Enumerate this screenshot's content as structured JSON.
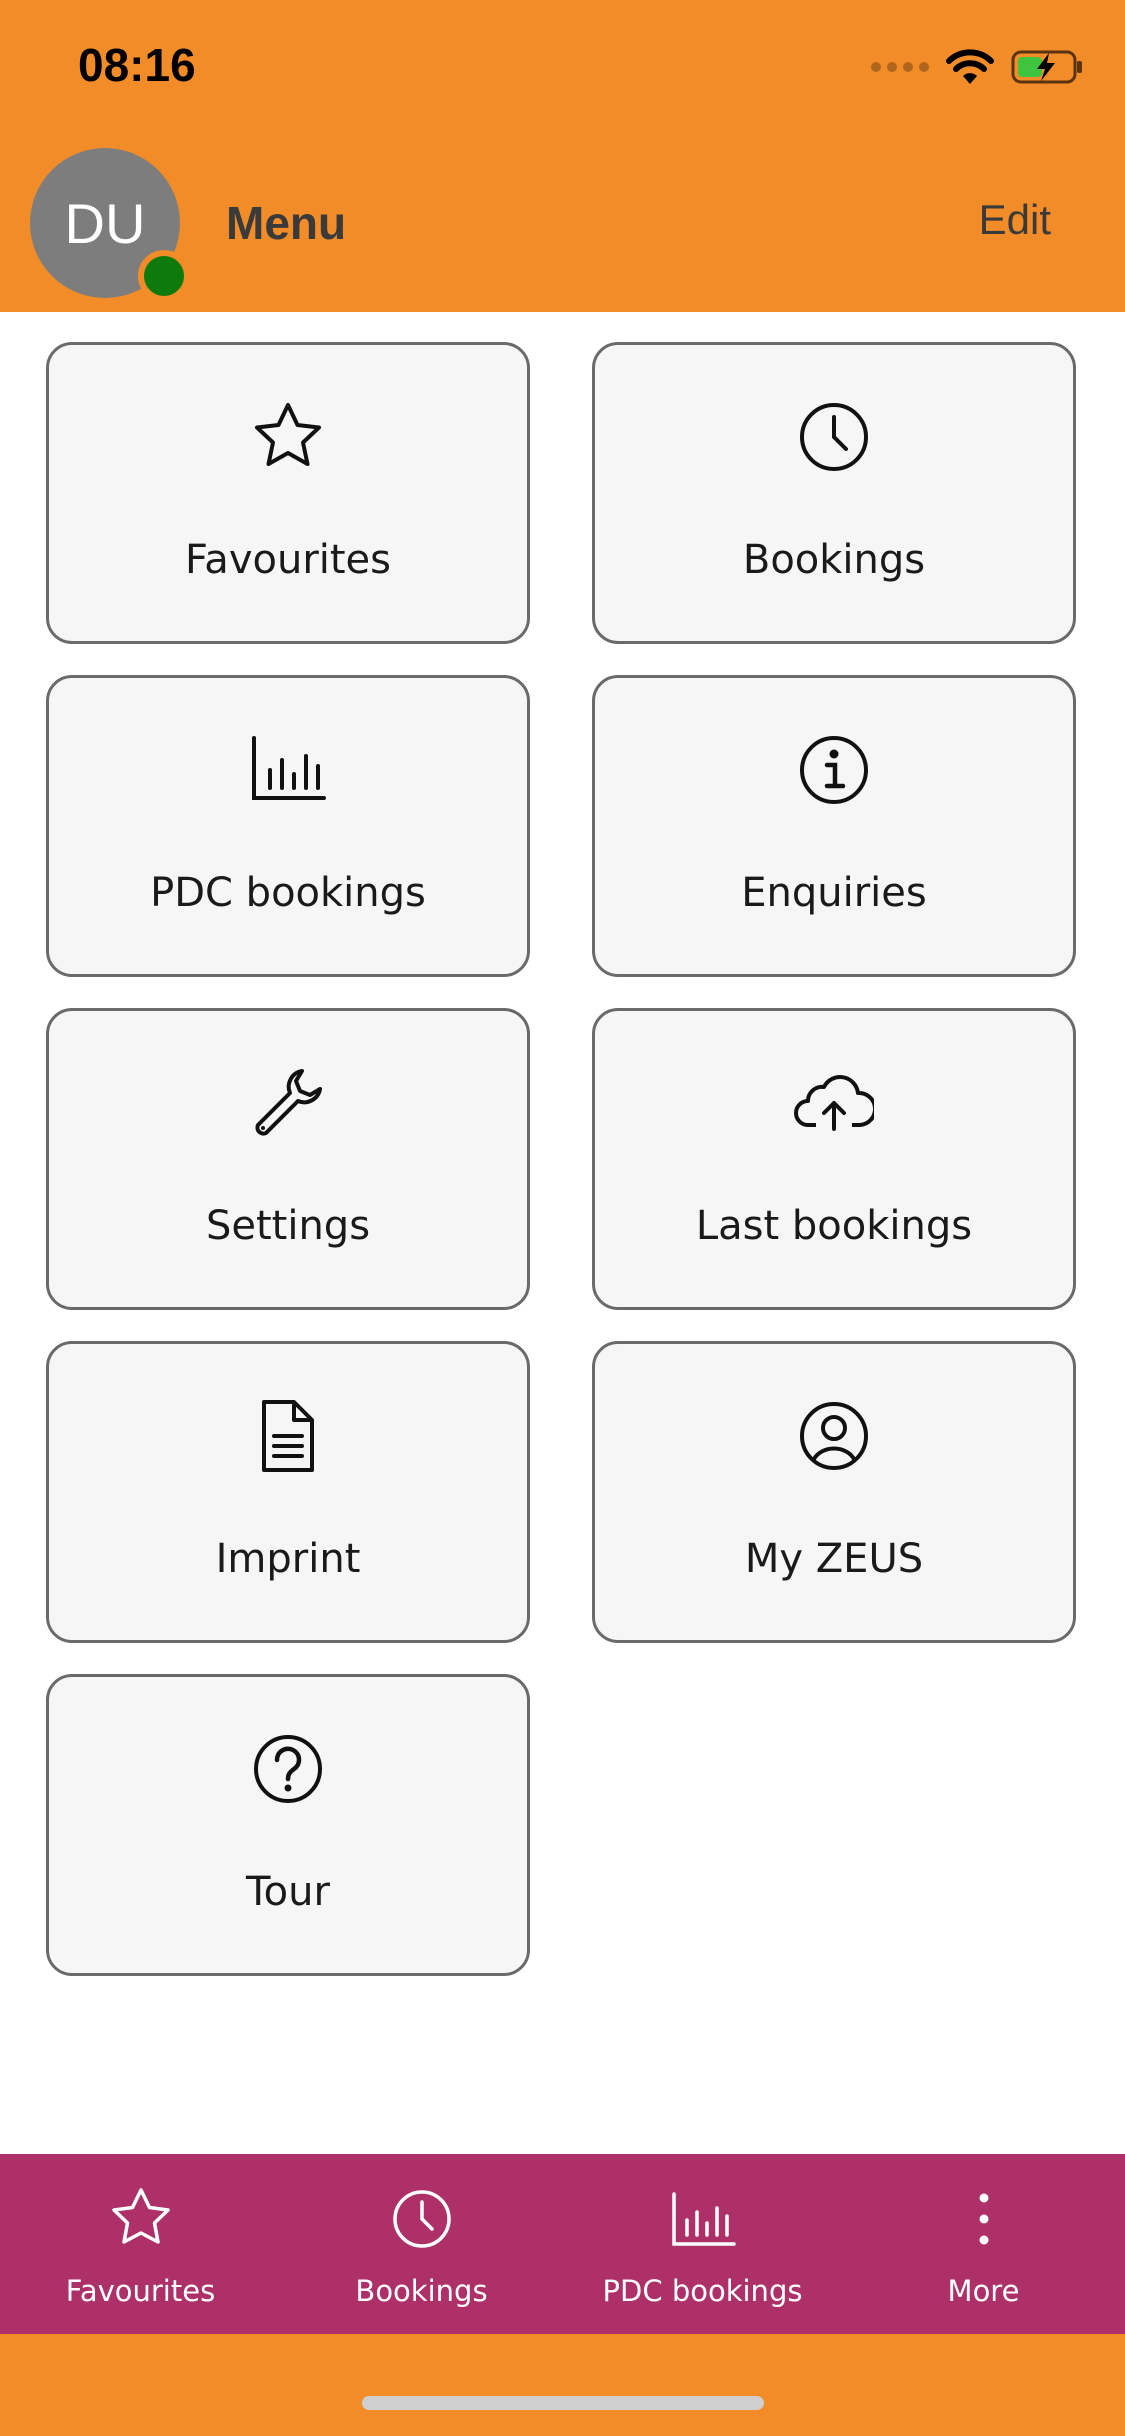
{
  "status_bar": {
    "time": "08:16"
  },
  "header": {
    "avatar_initials": "DU",
    "title": "Menu",
    "edit_label": "Edit"
  },
  "tiles": [
    {
      "label": "Favourites",
      "icon": "star-icon"
    },
    {
      "label": "Bookings",
      "icon": "clock-icon"
    },
    {
      "label": "PDC bookings",
      "icon": "bar-chart-icon"
    },
    {
      "label": "Enquiries",
      "icon": "info-icon"
    },
    {
      "label": "Settings",
      "icon": "wrench-icon"
    },
    {
      "label": "Last bookings",
      "icon": "cloud-upload-icon"
    },
    {
      "label": "Imprint",
      "icon": "document-icon"
    },
    {
      "label": "My ZEUS",
      "icon": "user-circle-icon"
    },
    {
      "label": "Tour",
      "icon": "help-icon"
    }
  ],
  "tabbar": [
    {
      "label": "Favourites",
      "icon": "star-icon"
    },
    {
      "label": "Bookings",
      "icon": "clock-icon"
    },
    {
      "label": "PDC bookings",
      "icon": "bar-chart-icon"
    },
    {
      "label": "More",
      "icon": "more-vertical-icon"
    }
  ],
  "colors": {
    "header_bg": "#f28c28",
    "tabbar_bg": "#ad3168",
    "presence": "#0c7a0c",
    "avatar_bg": "#7d7d7d"
  }
}
